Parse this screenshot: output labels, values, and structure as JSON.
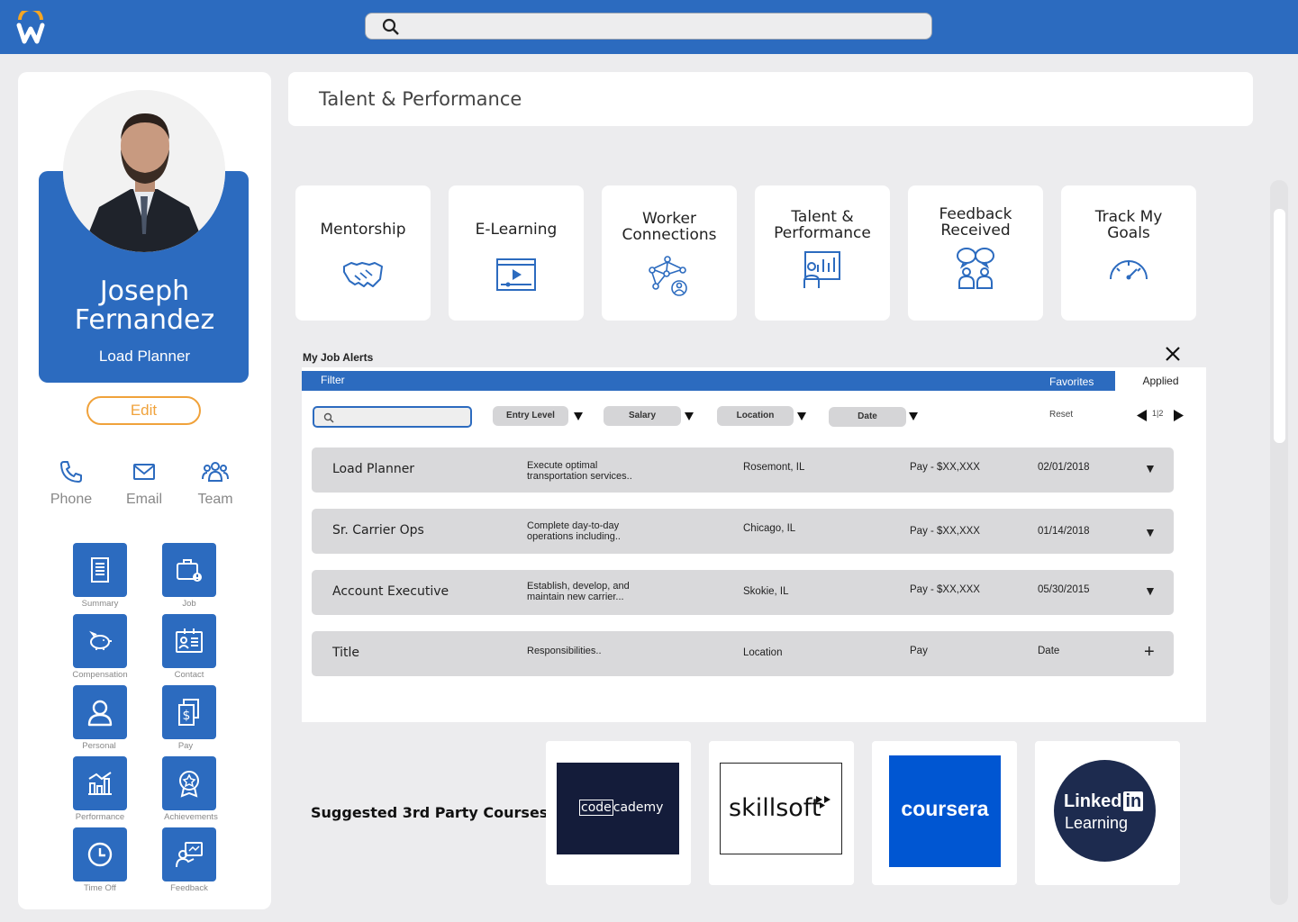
{
  "app": {
    "logo": "workday-logo",
    "search_icon": "search-icon"
  },
  "profile": {
    "name_line1": "Joseph",
    "name_line2": "Fernandez",
    "job_title": "Load Planner",
    "edit_label": "Edit"
  },
  "quick_actions": [
    {
      "label": "Phone",
      "icon": "phone-icon"
    },
    {
      "label": "Email",
      "icon": "email-icon"
    },
    {
      "label": "Team",
      "icon": "team-icon"
    }
  ],
  "nav_tiles": [
    {
      "label": "Summary",
      "icon": "document-icon"
    },
    {
      "label": "Job",
      "icon": "briefcase-icon"
    },
    {
      "label": "Compensation",
      "icon": "piggy-bank-icon"
    },
    {
      "label": "Contact",
      "icon": "contact-card-icon"
    },
    {
      "label": "Personal",
      "icon": "person-icon"
    },
    {
      "label": "Pay",
      "icon": "dollar-document-icon"
    },
    {
      "label": "Performance",
      "icon": "performance-chart-icon"
    },
    {
      "label": "Achievements",
      "icon": "award-icon"
    },
    {
      "label": "Time Off",
      "icon": "clock-icon"
    },
    {
      "label": "Feedback",
      "icon": "feedback-icon"
    }
  ],
  "page_title": "Talent & Performance",
  "feature_cards": [
    {
      "line1": "Mentorship",
      "line2": "",
      "icon": "handshake-icon"
    },
    {
      "line1": "E-Learning",
      "line2": "",
      "icon": "video-player-icon"
    },
    {
      "line1": "Worker",
      "line2": "Connections",
      "icon": "network-icon"
    },
    {
      "line1": "Talent &",
      "line2": "Performance",
      "icon": "presentation-icon"
    },
    {
      "line1": "Feedback",
      "line2": "Received",
      "icon": "people-speech-icon"
    },
    {
      "line1": "Track My",
      "line2": "Goals",
      "icon": "speedometer-icon"
    }
  ],
  "job_alerts": {
    "title": "My Job Alerts",
    "filter_label": "Filter",
    "tab_favorites": "Favorites",
    "tab_applied": "Applied",
    "filters": [
      "Entry Level",
      "Salary",
      "Location",
      "Date"
    ],
    "reset_label": "Reset",
    "pagination": "1|2",
    "rows": [
      {
        "title": "Load Planner",
        "desc1": "Execute optimal",
        "desc2": "transportation services..",
        "location": "Rosemont, IL",
        "pay": "Pay - $XX,XXX",
        "date": "02/01/2018",
        "toggle": "▼"
      },
      {
        "title": "Sr. Carrier Ops",
        "desc1": "Complete day-to-day",
        "desc2": "operations including..",
        "location": "Chicago, IL",
        "pay": "Pay - $XX,XXX",
        "date": "01/14/2018",
        "toggle": "▼"
      },
      {
        "title": "Account Executive",
        "desc1": "Establish, develop, and",
        "desc2": "maintain new carrier...",
        "location": "Skokie, IL",
        "pay": "Pay - $XX,XXX",
        "date": "05/30/2015",
        "toggle": "▼"
      },
      {
        "title": "Title",
        "desc1": "Responsibilities..",
        "desc2": "",
        "location": "Location",
        "pay": "Pay",
        "date": "Date",
        "toggle": "+"
      }
    ]
  },
  "courses": {
    "title": "Suggested 3rd Party Courses",
    "providers": [
      {
        "code": "code",
        "name": "cademy"
      },
      {
        "name": "skillsoft"
      },
      {
        "name": "coursera"
      },
      {
        "line1": "Linked",
        "badge": "in",
        "line2": "Learning"
      }
    ]
  },
  "colors": {
    "brand_blue": "#2c6bbf",
    "edit_orange": "#f0a23b",
    "coursera_blue": "#0056d2",
    "codecademy_navy": "#141c3a",
    "linkedin_navy": "#1d2b4f"
  }
}
